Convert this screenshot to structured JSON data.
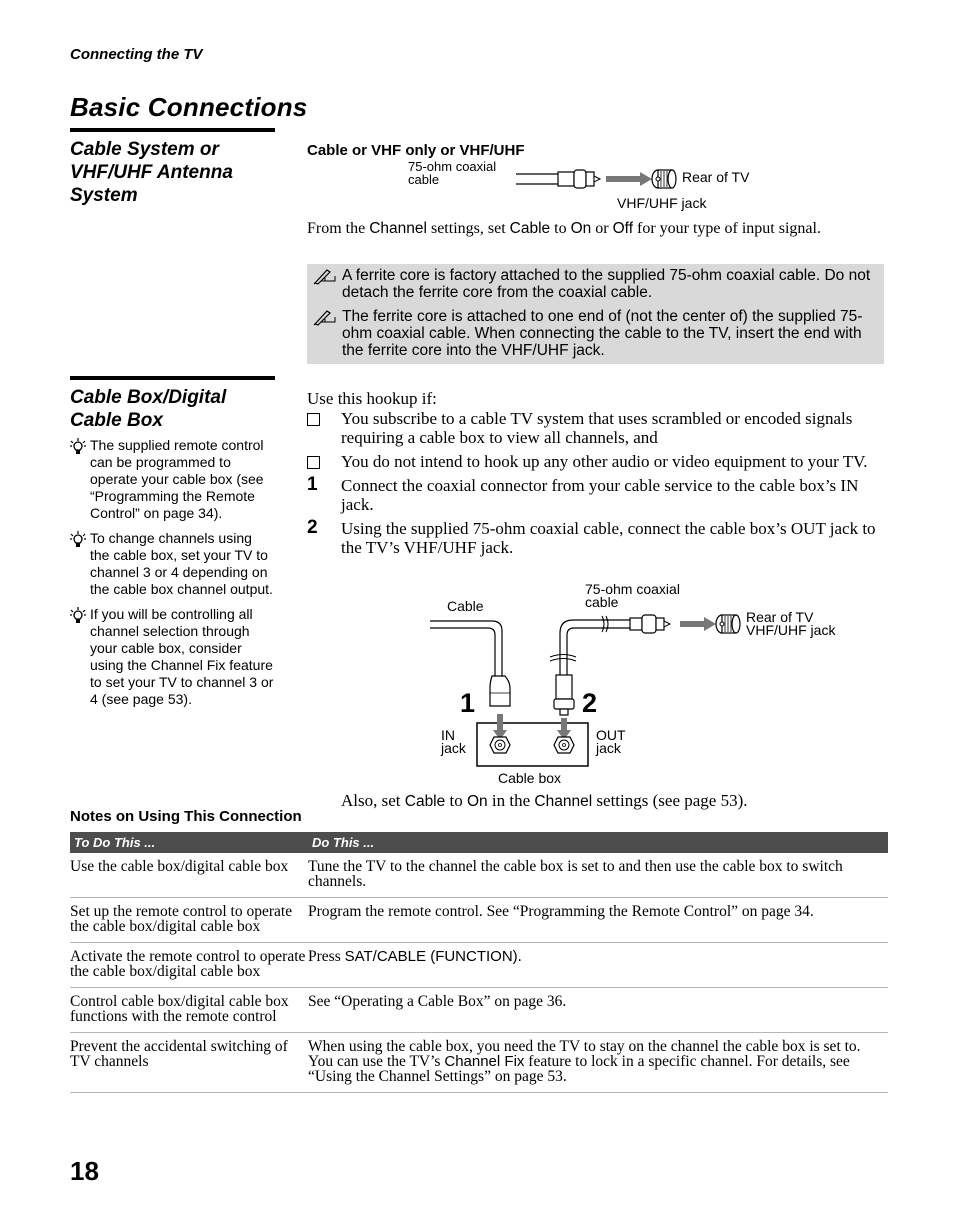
{
  "running_head": "Connecting the TV",
  "page_title": "Basic Connections",
  "section1": {
    "heading": "Cable System or VHF/UHF Antenna System",
    "subheading": "Cable or VHF only or VHF/UHF",
    "diagram": {
      "cable_label": "75-ohm coaxial cable",
      "rear_label": "Rear of TV",
      "jack_label": "VHF/UHF jack"
    },
    "instruction": {
      "t1": "From the ",
      "term_channel": "Channel",
      "t2": " settings, set ",
      "term_cable": "Cable",
      "t3": " to ",
      "term_on": "On",
      "t4": " or ",
      "term_off": "Off",
      "t5": " for your type of input signal."
    },
    "notes": [
      {
        "icon": "pencil-note-icon",
        "text": "A ferrite core is factory attached to the supplied 75-ohm coaxial cable. Do not detach the ferrite core from the coaxial cable."
      },
      {
        "icon": "pencil-note-icon",
        "text": "The ferrite core is attached to one end of (not the center of) the supplied 75-ohm coaxial cable. When connecting the cable to the TV, insert the end with the ferrite core into the VHF/UHF jack."
      }
    ]
  },
  "section2": {
    "heading": "Cable Box/Digital Cable Box",
    "tips": [
      {
        "icon": "lightbulb-tip-icon",
        "text": "The supplied remote control can be programmed to operate your cable box (see “Programming the Remote Control” on page 34)."
      },
      {
        "icon": "lightbulb-tip-icon",
        "text": "To change channels using the cable box, set your TV to channel 3 or 4 depending on the cable box channel output."
      },
      {
        "icon": "lightbulb-tip-icon",
        "text": "If you will be controlling all channel selection through your cable box, consider using the Channel Fix feature to set your TV to channel 3 or 4 (see page 53)."
      }
    ],
    "intro": "Use this hookup if:",
    "conditions": [
      "You subscribe to a cable TV system that uses scrambled or encoded signals requiring a cable box to view all channels, and",
      "You do not intend to hook up any other audio or video equipment to your TV."
    ],
    "steps": [
      {
        "num": "1",
        "text": "Connect the coaxial connector from your cable service to the cable box’s IN jack."
      },
      {
        "num": "2",
        "text": "Using the supplied 75-ohm coaxial cable, connect the cable box’s OUT jack to the TV’s VHF/UHF jack."
      }
    ],
    "diagram": {
      "cable_label": "Cable",
      "coax_label": "75-ohm coaxial cable",
      "rear_label": "Rear of TV",
      "jack_label": "VHF/UHF jack",
      "in_label": "IN jack",
      "out_label": "OUT jack",
      "box_label": "Cable box",
      "step1": "1",
      "step2": "2"
    },
    "also": {
      "t1": "Also, set ",
      "term_cable": "Cable",
      "t2": " to ",
      "term_on": "On",
      "t3": " in the ",
      "term_channel": "Channel",
      "t4": " settings (see page 53)."
    }
  },
  "notes_table": {
    "title": "Notes on Using This Connection",
    "headers": [
      "To Do This ...",
      "Do This ..."
    ],
    "rows": [
      {
        "todo": "Use the cable box/digital cable box",
        "do_pre": "Tune the TV to the channel the cable box is set to and then use the cable box to switch channels.",
        "term": "",
        "do_post": ""
      },
      {
        "todo": "Set up the remote control to operate the cable box/digital cable box",
        "do_pre": "Program the remote control. See “Programming the Remote Control” on page 34.",
        "term": "",
        "do_post": ""
      },
      {
        "todo": "Activate the remote control to operate the cable box/digital cable box",
        "do_pre": "Press ",
        "term": "SAT/CABLE (FUNCTION)",
        "do_post": "."
      },
      {
        "todo": "Control cable box/digital cable box functions with the remote control",
        "do_pre": "See “Operating a Cable Box” on page 36.",
        "term": "",
        "do_post": ""
      },
      {
        "todo": "Prevent the accidental switching of TV channels",
        "do_pre": "When using the cable box, you need the TV to stay on the channel the cable box is set to. You can use the TV’s ",
        "term": "Channel Fix",
        "do_post": " feature to lock in a specific channel. For details, see “Using the Channel Settings” on page 53."
      }
    ]
  },
  "page_number": "18"
}
